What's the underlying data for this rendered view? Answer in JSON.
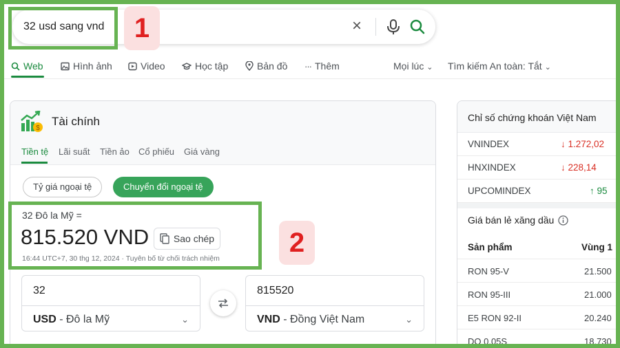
{
  "search": {
    "query": "32 usd sang vnd"
  },
  "annotations": {
    "badge1": "1",
    "badge2": "2"
  },
  "nav_tabs": [
    {
      "label": "Web",
      "icon": "search-icon"
    },
    {
      "label": "Hình ảnh",
      "icon": "image-icon"
    },
    {
      "label": "Video",
      "icon": "play-icon"
    },
    {
      "label": "Học tập",
      "icon": "graduation-cap-icon"
    },
    {
      "label": "Bản đồ",
      "icon": "map-pin-icon"
    },
    {
      "label": "Thêm",
      "icon": "more-dots-icon"
    }
  ],
  "filters": {
    "time": "Mọi lúc",
    "safe_search": "Tìm kiếm An toàn: Tắt"
  },
  "finance": {
    "title": "Tài chính",
    "tabs": [
      "Tiền tệ",
      "Lãi suất",
      "Tiền ảo",
      "Cổ phiếu",
      "Giá vàng"
    ],
    "pill_rate": "Tỷ giá ngoại tệ",
    "pill_convert": "Chuyển đổi ngoại tệ",
    "from_text": "32 Đô la Mỹ =",
    "result": "815.520 VND",
    "copy_label": "Sao chép",
    "meta": "16:44 UTC+7, 30 thg 12, 2024 · Tuyên bố từ chối trách nhiệm",
    "from_amount": "32",
    "from_code": "USD",
    "from_name": " - Đô la Mỹ",
    "to_amount": "815520",
    "to_code": "VND",
    "to_name": " - Đồng Việt Nam"
  },
  "side": {
    "stock_title": "Chỉ số chứng khoán Việt Nam",
    "stocks": [
      {
        "name": "VNINDEX",
        "value": "1.272,02",
        "direction": "down"
      },
      {
        "name": "HNXINDEX",
        "value": "228,14",
        "direction": "down"
      },
      {
        "name": "UPCOMINDEX",
        "value": "95",
        "direction": "up"
      }
    ],
    "fuel_title": "Giá bán lẻ xăng dầu",
    "fuel_col_product": "Sản phẩm",
    "fuel_col_zone": "Vùng 1",
    "fuel": [
      {
        "name": "RON 95-V",
        "price": "21.500"
      },
      {
        "name": "RON 95-III",
        "price": "21.000"
      },
      {
        "name": "E5 RON 92-II",
        "price": "20.240"
      },
      {
        "name": "DO 0,05S",
        "price": "18.730"
      }
    ]
  },
  "colors": {
    "highlight": "#67b352",
    "accent": "#1a8a3e",
    "badge_bg": "#fbe0e0",
    "badge_text": "#e02020",
    "down": "#d93025",
    "up": "#1a8a3e"
  }
}
